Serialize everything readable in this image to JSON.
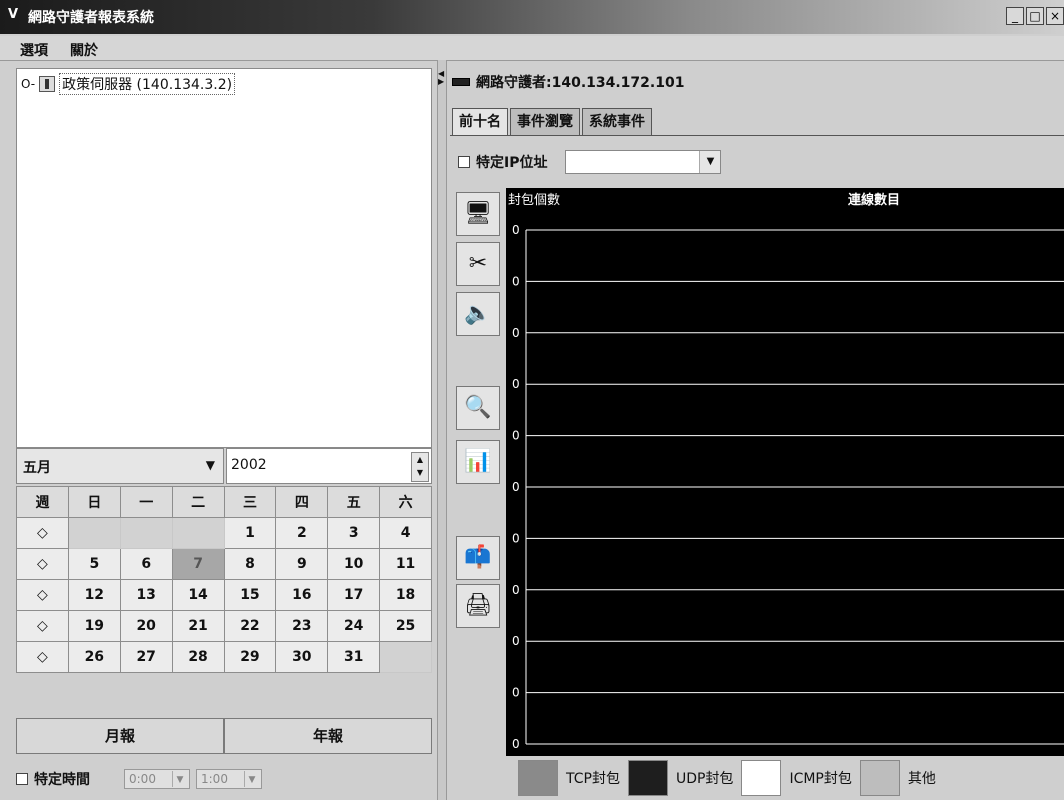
{
  "window": {
    "title": "網路守護者報表系統"
  },
  "menu": {
    "items": [
      "選項",
      "關於"
    ]
  },
  "tree": {
    "toggle": "O-",
    "server_label": "政策伺服器 (140.134.3.2)"
  },
  "date_selector": {
    "month": "五月",
    "year": "2002"
  },
  "calendar": {
    "weekday_headers": [
      "週",
      "日",
      "一",
      "二",
      "三",
      "四",
      "五",
      "六"
    ],
    "week_marker": "◇",
    "weeks": [
      [
        "",
        "",
        "",
        "1",
        "2",
        "3",
        "4"
      ],
      [
        "5",
        "6",
        "7",
        "8",
        "9",
        "10",
        "11"
      ],
      [
        "12",
        "13",
        "14",
        "15",
        "16",
        "17",
        "18"
      ],
      [
        "19",
        "20",
        "21",
        "22",
        "23",
        "24",
        "25"
      ],
      [
        "26",
        "27",
        "28",
        "29",
        "30",
        "31",
        ""
      ]
    ],
    "today": "7"
  },
  "reports": {
    "monthly": "月報",
    "yearly": "年報"
  },
  "time_filter": {
    "label": "特定時間",
    "start": "0:00",
    "end": "1:00"
  },
  "right_panel": {
    "title": "網路守護者:140.134.172.101",
    "tabs": [
      "前十名",
      "事件瀏覽",
      "系統事件"
    ],
    "ip_filter_label": "特定IP位址"
  },
  "tool_icons": [
    "monitor-icon",
    "tools-icon",
    "speaker-icon",
    "search-icon",
    "bar-chart-icon",
    "mailbox-icon",
    "printer-icon"
  ],
  "chart_data": {
    "type": "bar",
    "title": "連線數目",
    "ylabel": "封包個數",
    "y_ticks": [
      "0",
      "0",
      "0",
      "0",
      "0",
      "0",
      "0",
      "0",
      "0",
      "0",
      "0"
    ],
    "series": [
      {
        "name": "TCP封包",
        "color": "#8a8a8a"
      },
      {
        "name": "UDP封包",
        "color": "#1e1e1e"
      },
      {
        "name": "ICMP封包",
        "color": "#ffffff"
      },
      {
        "name": "其他",
        "color": "#bdbdbd"
      }
    ],
    "values": []
  }
}
